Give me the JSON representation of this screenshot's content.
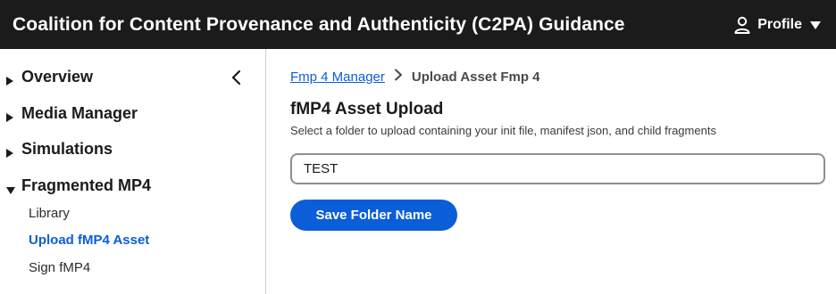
{
  "header": {
    "title": "Coalition for Content Provenance and Authenticity (C2PA) Guidance",
    "profile_label": "Profile",
    "profile_icon": "user-icon",
    "profile_caret_icon": "caret-down-icon"
  },
  "sidebar": {
    "collapse_icon": "chevron-left-icon",
    "sections": [
      {
        "label": "Overview",
        "expanded": false
      },
      {
        "label": "Media Manager",
        "expanded": false
      },
      {
        "label": "Simulations",
        "expanded": false
      },
      {
        "label": "Fragmented MP4",
        "expanded": true
      }
    ],
    "sub_items": [
      {
        "label": "Library",
        "active": false
      },
      {
        "label": "Upload fMP4 Asset",
        "active": true
      },
      {
        "label": "Sign fMP4",
        "active": false
      }
    ]
  },
  "breadcrumb": {
    "parent": "Fmp 4 Manager",
    "current": "Upload Asset Fmp 4",
    "separator_icon": "chevron-right-icon"
  },
  "main": {
    "title": "fMP4 Asset Upload",
    "description": "Select a folder to upload containing your init file, manifest json, and child fragments",
    "folder_input_value": "TEST",
    "save_button_label": "Save Folder Name"
  },
  "colors": {
    "header_bg": "#1b1b1b",
    "accent": "#0b5ed7",
    "border": "#8f8f8f"
  }
}
